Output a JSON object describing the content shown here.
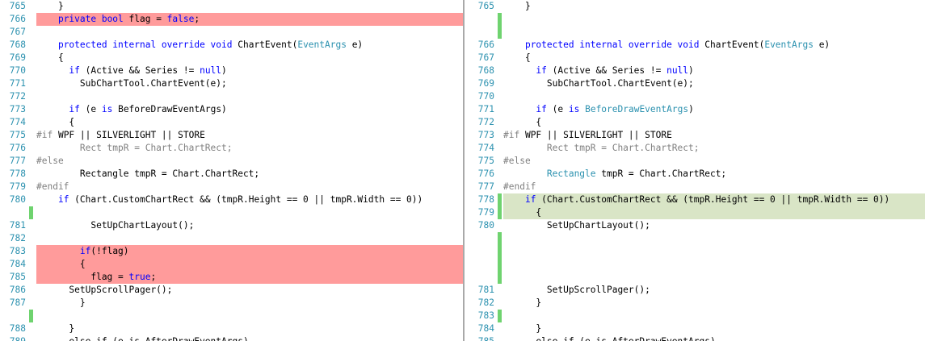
{
  "colors": {
    "removed": "#ff9b9b",
    "added": "#d9e5c6",
    "change_bar": "#6fd36f",
    "line_number": "#2b91af",
    "keyword": "#0000ff",
    "type": "#2b91af",
    "preprocessor": "#808080"
  },
  "left": [
    {
      "ln": "765",
      "state": "normal",
      "tokens": [
        {
          "c": "",
          "t": "    }"
        }
      ]
    },
    {
      "ln": "766",
      "state": "removed",
      "tokens": [
        {
          "c": "",
          "t": "    "
        },
        {
          "c": "kw",
          "t": "private bool"
        },
        {
          "c": "",
          "t": " flag = "
        },
        {
          "c": "kw",
          "t": "false"
        },
        {
          "c": "",
          "t": ";"
        }
      ]
    },
    {
      "ln": "767",
      "state": "removed",
      "tokens": []
    },
    {
      "ln": "768",
      "state": "normal",
      "tokens": [
        {
          "c": "",
          "t": "    "
        },
        {
          "c": "kw",
          "t": "protected internal override void"
        },
        {
          "c": "",
          "t": " ChartEvent("
        },
        {
          "c": "ty",
          "t": "EventArgs"
        },
        {
          "c": "",
          "t": " e)"
        }
      ]
    },
    {
      "ln": "769",
      "state": "normal",
      "tokens": [
        {
          "c": "",
          "t": "    {"
        }
      ]
    },
    {
      "ln": "770",
      "state": "normal",
      "tokens": [
        {
          "c": "",
          "t": "      "
        },
        {
          "c": "kw",
          "t": "if"
        },
        {
          "c": "",
          "t": " (Active && Series != "
        },
        {
          "c": "kw",
          "t": "null"
        },
        {
          "c": "",
          "t": ")"
        }
      ]
    },
    {
      "ln": "771",
      "state": "normal",
      "tokens": [
        {
          "c": "",
          "t": "        SubChartTool.ChartEvent(e);"
        }
      ]
    },
    {
      "ln": "772",
      "state": "normal",
      "tokens": []
    },
    {
      "ln": "773",
      "state": "normal",
      "tokens": [
        {
          "c": "",
          "t": "      "
        },
        {
          "c": "kw",
          "t": "if"
        },
        {
          "c": "",
          "t": " (e "
        },
        {
          "c": "kw",
          "t": "is"
        },
        {
          "c": "",
          "t": " BeforeDrawEventArgs)"
        }
      ]
    },
    {
      "ln": "774",
      "state": "normal",
      "tokens": [
        {
          "c": "",
          "t": "      {"
        }
      ]
    },
    {
      "ln": "775",
      "state": "normal",
      "tokens": [
        {
          "c": "pp",
          "t": "#if"
        },
        {
          "c": "",
          "t": " WPF || SILVERLIGHT || STORE"
        }
      ]
    },
    {
      "ln": "776",
      "state": "normal",
      "tokens": [
        {
          "c": "gr",
          "t": "        Rect tmpR = Chart.ChartRect;"
        }
      ]
    },
    {
      "ln": "777",
      "state": "normal",
      "tokens": [
        {
          "c": "pp",
          "t": "#else"
        }
      ]
    },
    {
      "ln": "778",
      "state": "normal",
      "tokens": [
        {
          "c": "",
          "t": "        Rectangle tmpR = Chart.ChartRect;"
        }
      ]
    },
    {
      "ln": "779",
      "state": "normal",
      "tokens": [
        {
          "c": "pp",
          "t": "#endif"
        }
      ]
    },
    {
      "ln": "780",
      "state": "normal",
      "tokens": [
        {
          "c": "",
          "t": "    "
        },
        {
          "c": "kw",
          "t": "if"
        },
        {
          "c": "",
          "t": " (Chart.CustomChartRect && (tmpR.Height == 0 || tmpR.Width == 0))"
        }
      ]
    },
    {
      "ln": "",
      "state": "filler",
      "tokens": []
    },
    {
      "ln": "781",
      "state": "normal",
      "tokens": [
        {
          "c": "",
          "t": "          SetUpChartLayout();"
        }
      ]
    },
    {
      "ln": "782",
      "state": "removed",
      "tokens": []
    },
    {
      "ln": "783",
      "state": "removed",
      "tokens": [
        {
          "c": "",
          "t": "        "
        },
        {
          "c": "kw",
          "t": "if"
        },
        {
          "c": "",
          "t": "(!flag)"
        }
      ]
    },
    {
      "ln": "784",
      "state": "removed",
      "tokens": [
        {
          "c": "",
          "t": "        {"
        }
      ]
    },
    {
      "ln": "785",
      "state": "removed",
      "tokens": [
        {
          "c": "",
          "t": "          flag = "
        },
        {
          "c": "kw",
          "t": "true"
        },
        {
          "c": "",
          "t": ";"
        }
      ]
    },
    {
      "ln": "786",
      "state": "normal",
      "tokens": [
        {
          "c": "",
          "t": "      SetUpScrollPager();"
        }
      ]
    },
    {
      "ln": "787",
      "state": "normal",
      "tokens": [
        {
          "c": "",
          "t": "        }"
        }
      ]
    },
    {
      "ln": "",
      "state": "filler",
      "tokens": []
    },
    {
      "ln": "788",
      "state": "normal",
      "tokens": [
        {
          "c": "",
          "t": "      }"
        }
      ]
    },
    {
      "ln": "789",
      "state": "normal",
      "tokens": [
        {
          "c": "",
          "t": "      else if (e is AfterDrawEventArgs)"
        }
      ]
    }
  ],
  "right": [
    {
      "ln": "765",
      "state": "normal",
      "tokens": [
        {
          "c": "",
          "t": "    }"
        }
      ]
    },
    {
      "ln": "",
      "state": "filler",
      "tokens": []
    },
    {
      "ln": "",
      "state": "filler",
      "tokens": []
    },
    {
      "ln": "766",
      "state": "normal",
      "tokens": [
        {
          "c": "",
          "t": "    "
        },
        {
          "c": "kw",
          "t": "protected internal override void"
        },
        {
          "c": "",
          "t": " ChartEvent("
        },
        {
          "c": "ty",
          "t": "EventArgs"
        },
        {
          "c": "",
          "t": " e)"
        }
      ]
    },
    {
      "ln": "767",
      "state": "normal",
      "tokens": [
        {
          "c": "",
          "t": "    {"
        }
      ]
    },
    {
      "ln": "768",
      "state": "normal",
      "tokens": [
        {
          "c": "",
          "t": "      "
        },
        {
          "c": "kw",
          "t": "if"
        },
        {
          "c": "",
          "t": " (Active && Series != "
        },
        {
          "c": "kw",
          "t": "null"
        },
        {
          "c": "",
          "t": ")"
        }
      ]
    },
    {
      "ln": "769",
      "state": "normal",
      "tokens": [
        {
          "c": "",
          "t": "        SubChartTool.ChartEvent(e);"
        }
      ]
    },
    {
      "ln": "770",
      "state": "normal",
      "tokens": []
    },
    {
      "ln": "771",
      "state": "normal",
      "tokens": [
        {
          "c": "",
          "t": "      "
        },
        {
          "c": "kw",
          "t": "if"
        },
        {
          "c": "",
          "t": " (e "
        },
        {
          "c": "kw",
          "t": "is"
        },
        {
          "c": "",
          "t": " "
        },
        {
          "c": "ty",
          "t": "BeforeDrawEventArgs"
        },
        {
          "c": "",
          "t": ")"
        }
      ]
    },
    {
      "ln": "772",
      "state": "normal",
      "tokens": [
        {
          "c": "",
          "t": "      {"
        }
      ]
    },
    {
      "ln": "773",
      "state": "normal",
      "tokens": [
        {
          "c": "pp",
          "t": "#if"
        },
        {
          "c": "",
          "t": " WPF || SILVERLIGHT || STORE"
        }
      ]
    },
    {
      "ln": "774",
      "state": "normal",
      "tokens": [
        {
          "c": "gr",
          "t": "        Rect tmpR = Chart.ChartRect;"
        }
      ]
    },
    {
      "ln": "775",
      "state": "normal",
      "tokens": [
        {
          "c": "pp",
          "t": "#else"
        }
      ]
    },
    {
      "ln": "776",
      "state": "normal",
      "tokens": [
        {
          "c": "",
          "t": "        "
        },
        {
          "c": "ty",
          "t": "Rectangle"
        },
        {
          "c": "",
          "t": " tmpR = Chart.ChartRect;"
        }
      ]
    },
    {
      "ln": "777",
      "state": "normal",
      "tokens": [
        {
          "c": "pp",
          "t": "#endif"
        }
      ]
    },
    {
      "ln": "778",
      "state": "added",
      "tokens": [
        {
          "c": "",
          "t": "    "
        },
        {
          "c": "kw",
          "t": "if"
        },
        {
          "c": "",
          "t": " (Chart.CustomChartRect && (tmpR.Height == 0 || tmpR.Width == 0))"
        }
      ]
    },
    {
      "ln": "779",
      "state": "added",
      "tokens": [
        {
          "c": "",
          "t": "      {"
        }
      ]
    },
    {
      "ln": "780",
      "state": "normal",
      "tokens": [
        {
          "c": "",
          "t": "        SetUpChartLayout();"
        }
      ]
    },
    {
      "ln": "",
      "state": "filler",
      "tokens": []
    },
    {
      "ln": "",
      "state": "filler",
      "tokens": []
    },
    {
      "ln": "",
      "state": "filler",
      "tokens": []
    },
    {
      "ln": "",
      "state": "filler",
      "tokens": []
    },
    {
      "ln": "781",
      "state": "normal",
      "tokens": [
        {
          "c": "",
          "t": "        SetUpScrollPager();"
        }
      ]
    },
    {
      "ln": "782",
      "state": "normal",
      "tokens": [
        {
          "c": "",
          "t": "      }"
        }
      ]
    },
    {
      "ln": "783",
      "state": "added",
      "tokens": []
    },
    {
      "ln": "784",
      "state": "normal",
      "tokens": [
        {
          "c": "",
          "t": "      }"
        }
      ]
    },
    {
      "ln": "785",
      "state": "normal",
      "tokens": [
        {
          "c": "",
          "t": "      else if (e is AfterDrawEventArgs)"
        }
      ]
    }
  ]
}
